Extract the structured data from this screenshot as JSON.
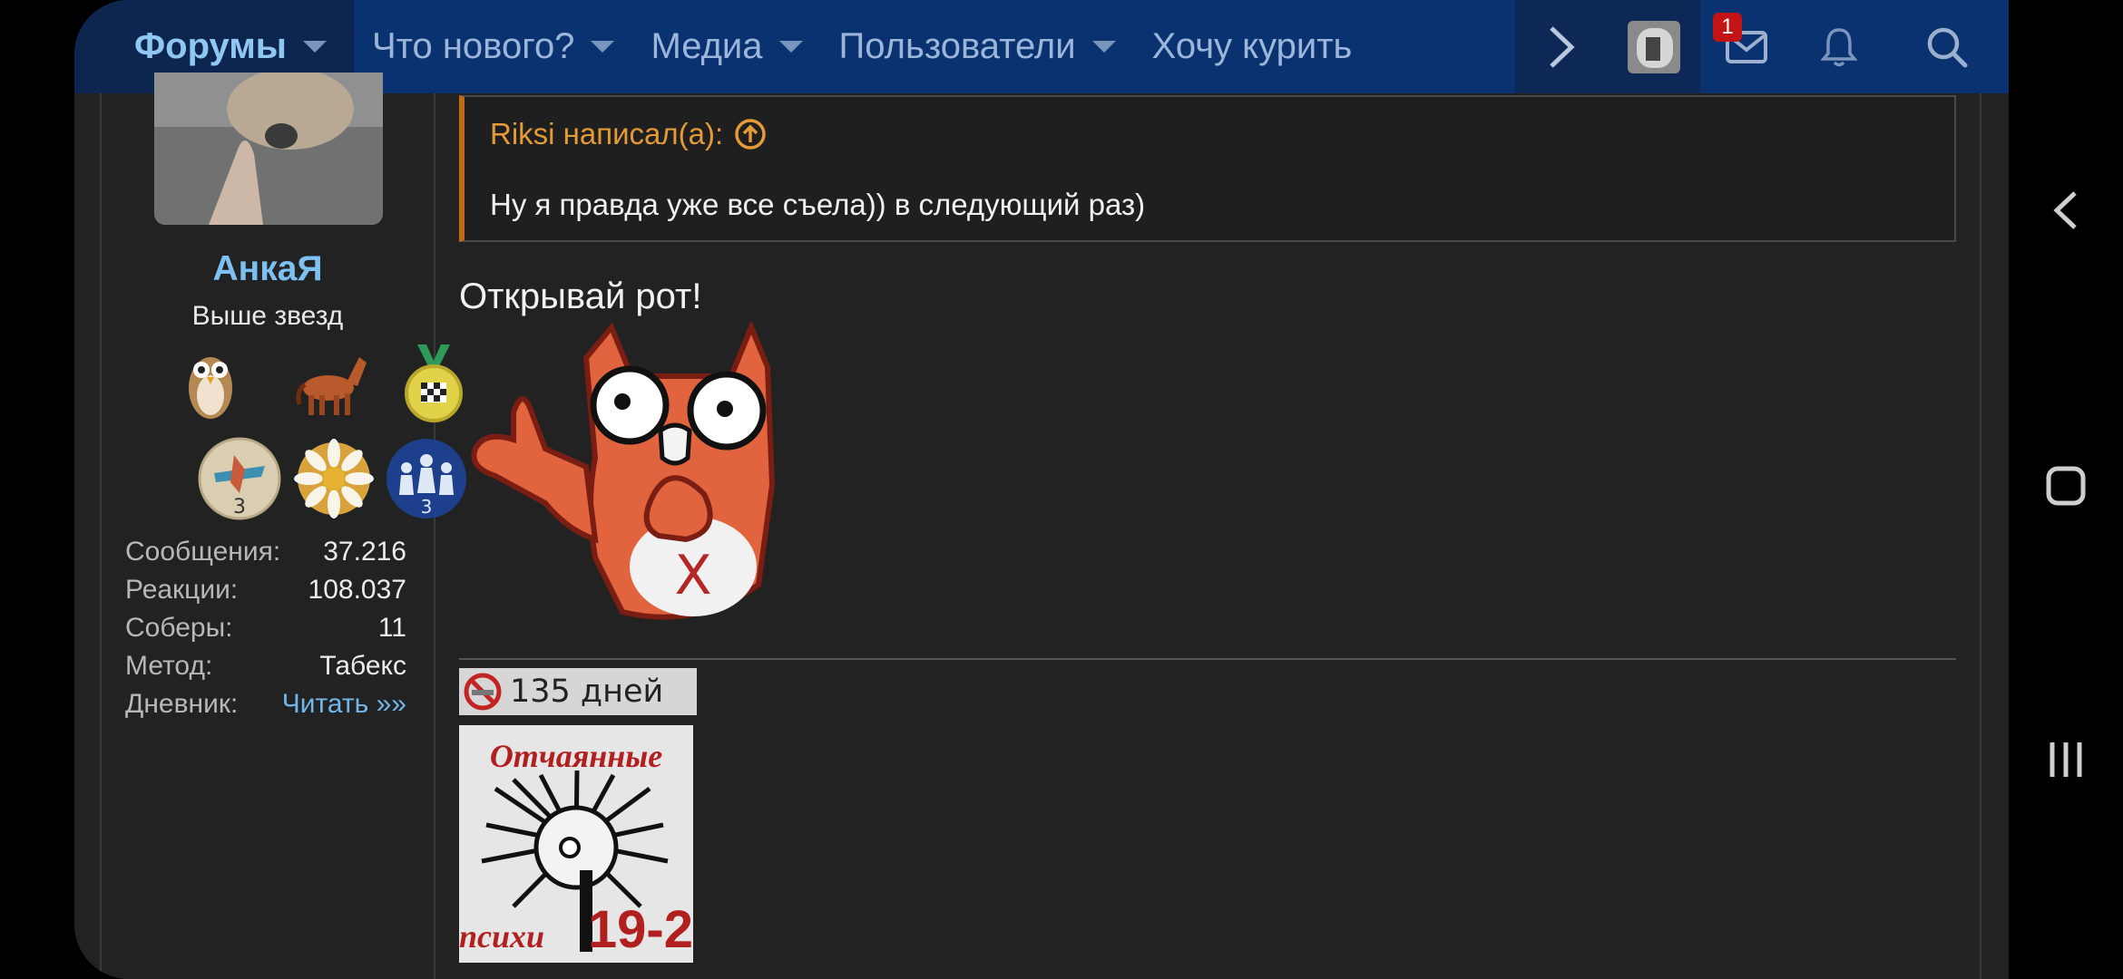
{
  "topnav": {
    "tabs": [
      {
        "label": "Форумы",
        "has_caret": true
      },
      {
        "label": "Что нового?",
        "has_caret": true
      },
      {
        "label": "Медиа",
        "has_caret": true
      },
      {
        "label": "Пользователи",
        "has_caret": true
      },
      {
        "label": "Хочу курить",
        "has_caret": false
      }
    ],
    "messages_badge": "1",
    "icons": [
      "chevron-right-icon",
      "user-avatar",
      "envelope-icon",
      "bell-icon",
      "search-icon"
    ]
  },
  "user": {
    "name": "АнкаЯ",
    "title": "Выше звезд",
    "stats": [
      {
        "label": "Сообщения:",
        "value": "37.216"
      },
      {
        "label": "Реакции:",
        "value": "108.037"
      },
      {
        "label": "Соберы:",
        "value": "11"
      },
      {
        "label": "Метод:",
        "value": "Табекс"
      },
      {
        "label": "Дневник:",
        "value": "Читать »»"
      }
    ]
  },
  "quote": {
    "author": "Riksi написал(а):",
    "text": "Ну я правда уже все съела)) в следующий раз)"
  },
  "post": {
    "text": "Открывай рот!"
  },
  "signature": {
    "days_text": "135 дней",
    "image_caption_top": "Отчаянные",
    "image_caption_bottom_left": "психи",
    "image_caption_bottom_right": "19-2"
  },
  "colors": {
    "nav_bg": "#0b3270",
    "username": "#7cc1f2",
    "quote_accent": "#c06a13",
    "badge": "#c21414"
  }
}
